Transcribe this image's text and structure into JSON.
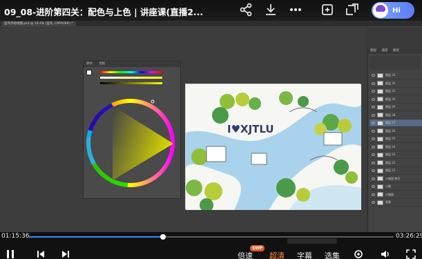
{
  "player": {
    "title": "09_08-进阶第四关：配色与上色 | 讲座课(直播2...",
    "icons": [
      "share-icon",
      "download-icon",
      "more-icon",
      "screenshot-icon",
      "picture-in-picture-icon"
    ],
    "assistant_label": "Hi",
    "current_time": "01:15:36",
    "total_time": "03:26:29",
    "progress": 0.3668,
    "badge": "SWP",
    "controls": {
      "speed": "倍速",
      "quality": "超清",
      "subtitle": "字幕",
      "episodes": "选集"
    }
  },
  "photoshop": {
    "doc_tab": "蓝鸟手绘地图.psd @ 16.4% (蓝鸟, CMYK/8#) *",
    "color_panel": {
      "tabs": [
        "颜色",
        "色板"
      ],
      "hue_color": "#d9d900"
    },
    "layers_panel": {
      "tabs": [
        "图层",
        "通道",
        "路径"
      ],
      "layers": [
        "图层 33",
        "图层 32",
        "图层 31",
        "图层 30",
        "图层 29",
        "图层 28",
        "图层 27",
        "图层 26",
        "图层 25",
        "图层 24",
        "图层 23",
        "图层 22",
        "图层 21",
        "小路面 拷贝",
        "小路",
        "小路面",
        "背景"
      ]
    },
    "artwork_title": "I♥XJTLU"
  }
}
